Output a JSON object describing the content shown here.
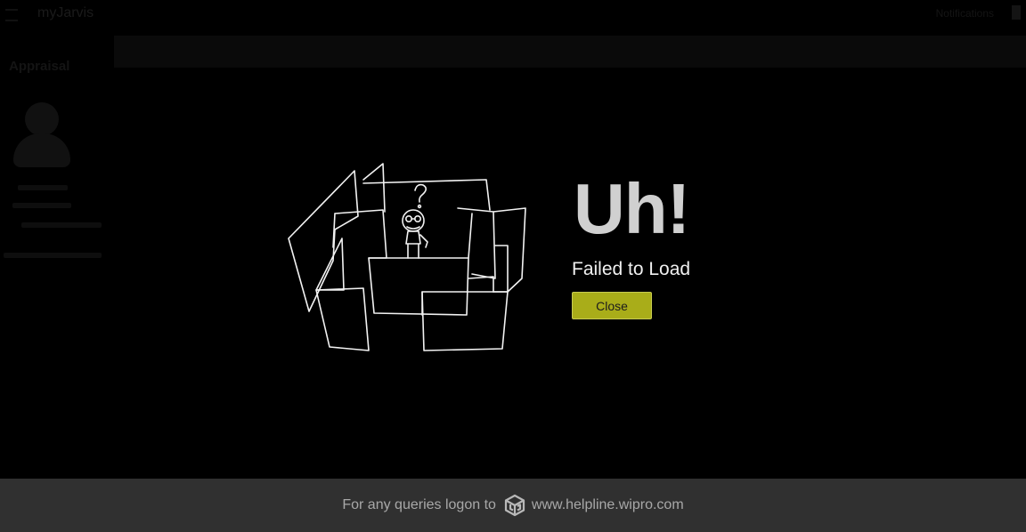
{
  "background_app": {
    "logo_text": "myJarvis",
    "sidebar_title": "Appraisal",
    "top_right_text": "Notifications"
  },
  "error": {
    "title": "Uh!",
    "message": "Failed to Load",
    "close_label": "Close",
    "illustration": "maze-with-confused-person"
  },
  "footer": {
    "text": "For any queries logon to",
    "icon": "wipro-helpline-cube-icon",
    "link": "www.helpline.wipro.com"
  },
  "colors": {
    "page_background": "#000000",
    "title": "#d0d0d0",
    "message": "#f0f0f0",
    "button_background": "#a9ad19",
    "footer_background": "#303030",
    "footer_text": "#a8a8a8"
  }
}
